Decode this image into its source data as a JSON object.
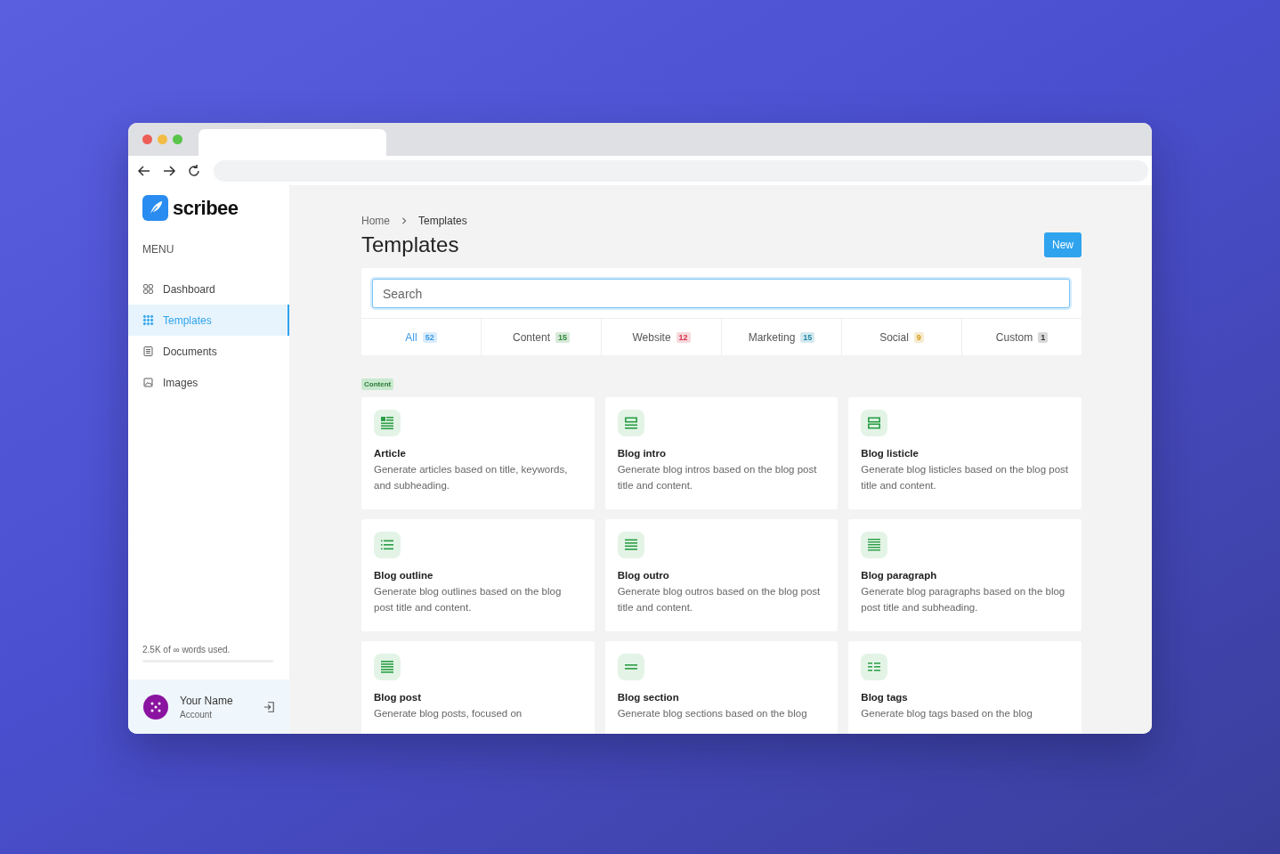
{
  "sidebar": {
    "logo": "scribee",
    "menu_label": "MENU",
    "items": [
      {
        "label": "Dashboard",
        "kind": "dashboard",
        "selected": false
      },
      {
        "label": "Templates",
        "kind": "templates",
        "selected": true
      },
      {
        "label": "Documents",
        "kind": "documents",
        "selected": false
      },
      {
        "label": "Images",
        "kind": "images",
        "selected": false
      }
    ],
    "usage": {
      "text": "2.5K of ∞ words used."
    },
    "user": {
      "name": "Your Name",
      "subtitle": "Account"
    }
  },
  "breadcrumb": [
    "Home",
    "Templates"
  ],
  "title": "Templates",
  "new_button": "New",
  "search": {
    "placeholder": "Search"
  },
  "tabs": [
    {
      "label": "All",
      "count": "52",
      "color": "#3b9ae8",
      "selected": true
    },
    {
      "label": "Content",
      "count": "15",
      "color": "#2e8b3a",
      "selected": false
    },
    {
      "label": "Website",
      "count": "12",
      "color": "#d6334a",
      "selected": false
    },
    {
      "label": "Marketing",
      "count": "15",
      "color": "#1f88a8",
      "selected": false
    },
    {
      "label": "Social",
      "count": "9",
      "color": "#d39a10",
      "selected": false
    },
    {
      "label": "Custom",
      "count": "1",
      "color": "#333333",
      "selected": false
    }
  ],
  "section_tag": "Content",
  "cards": [
    {
      "kind": "article",
      "title": "Article",
      "description": "Generate articles based on title, keywords, and subheading."
    },
    {
      "kind": "intro",
      "title": "Blog intro",
      "description": "Generate blog intros based on the blog post title and content."
    },
    {
      "kind": "listicle",
      "title": "Blog listicle",
      "description": "Generate blog listicles based on the blog post title and content."
    },
    {
      "kind": "outline",
      "title": "Blog outline",
      "description": "Generate blog outlines based on the blog post title and content."
    },
    {
      "kind": "outro",
      "title": "Blog outro",
      "description": "Generate blog outros based on the blog post title and content."
    },
    {
      "kind": "paragraph",
      "title": "Blog paragraph",
      "description": "Generate blog paragraphs based on the blog post title and subheading."
    },
    {
      "kind": "post",
      "title": "Blog post",
      "description": "Generate blog posts, focused on"
    },
    {
      "kind": "section",
      "title": "Blog section",
      "description": "Generate blog sections based on the blog"
    },
    {
      "kind": "tags",
      "title": "Blog tags",
      "description": "Generate blog tags based on the blog"
    }
  ]
}
